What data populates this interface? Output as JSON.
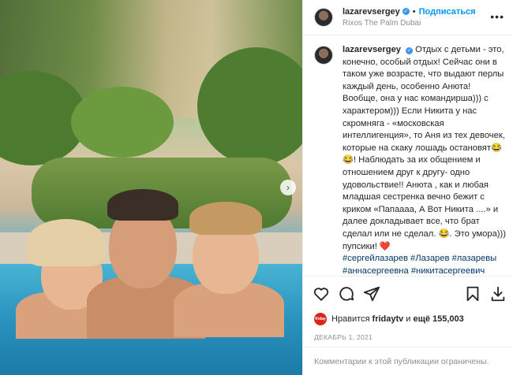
{
  "header": {
    "username": "lazarevsergey",
    "separator": "•",
    "follow_label": "Подписаться",
    "location": "Rixos The Palm Dubai"
  },
  "caption": {
    "username": "lazarevsergey",
    "text": "Отдых с детьми - это, конечно, особый отдых! Сейчас они в таком уже возрасте, что выдают перлы каждый день, особенно Анюта! Вообще, она у нас командирша))) с характером))) Если Никита у нас скромняга - «московская интеллигенция», то Аня из тех девочек, которые на скаку лошадь остановят😂😂! Наблюдать за их общением и отношением друг к другу- одно удовольствие!! Анюта , как и любая младшая сестренка вечно бежит с криком «Папаааа, А Вот Никита ....» и далее докладывает все, что брат сделал или не сделал. 😂. Это умора))) пупсики! ❤️",
    "tags": [
      "#сергейлазарев",
      "#Лазарев",
      "#лазаревы",
      "#аннасергеевна",
      "#никитасергеевич"
    ]
  },
  "likes": {
    "avatar_label": "friday",
    "prefix": "Нравится",
    "user": "fridaytv",
    "conjunction": "и",
    "count": "ещё 155,003"
  },
  "date": "ДЕКАБРЬ 1, 2021",
  "comments_notice": "Комментарии к этой публикации ограничены.",
  "icons": {
    "like": "heart-icon",
    "comment": "comment-icon",
    "share": "share-icon",
    "save": "bookmark-icon",
    "download": "download-icon",
    "more": "more-icon",
    "next": "chevron-right-icon"
  },
  "colors": {
    "link_blue": "#0095f6",
    "hashtag": "#00376b",
    "muted": "#8e8e8e",
    "verified": "#3897f0"
  }
}
